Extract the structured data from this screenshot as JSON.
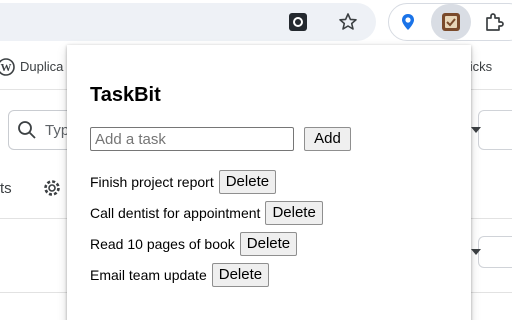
{
  "browser": {
    "bookmarks": [
      {
        "label": "Duplica"
      },
      {
        "label": "s ticks"
      }
    ]
  },
  "page": {
    "search_placeholder": "Typ",
    "settings_label": "ts"
  },
  "popup": {
    "title": "TaskBit",
    "input_placeholder": "Add a task",
    "input_value": "",
    "add_label": "Add",
    "tasks": [
      {
        "label": "Finish project report",
        "delete_label": "Delete"
      },
      {
        "label": "Call dentist for appointment",
        "delete_label": "Delete"
      },
      {
        "label": "Read 10 pages of book",
        "delete_label": "Delete"
      },
      {
        "label": "Email team update",
        "delete_label": "Delete"
      }
    ]
  },
  "colors": {
    "omnibox_bg": "#eef1f6",
    "button_bg": "#efefef",
    "active_extension_bg": "#d9dde4"
  }
}
